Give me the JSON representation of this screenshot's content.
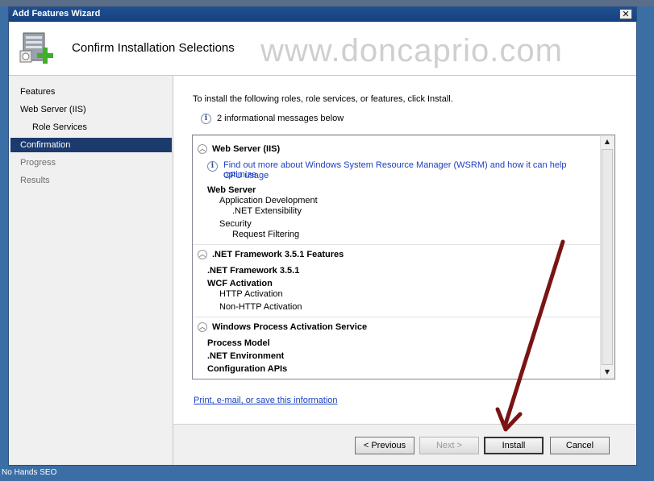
{
  "window": {
    "title": "Add Features Wizard"
  },
  "header": {
    "title": "Confirm Installation Selections",
    "watermark": "www.doncaprio.com"
  },
  "nav": {
    "items": [
      {
        "label": "Features"
      },
      {
        "label": "Web Server (IIS)"
      },
      {
        "label": "Role Services"
      },
      {
        "label": "Confirmation"
      },
      {
        "label": "Progress"
      },
      {
        "label": "Results"
      }
    ]
  },
  "content": {
    "intro": "To install the following roles, role services, or features, click Install.",
    "info_count_text": "2 informational messages below",
    "sections": [
      {
        "title": "Web Server (IIS)",
        "link": "Find out more about Windows System Resource Manager (WSRM) and how it can help optimize CPU usage",
        "link_line1": "Find out more about Windows System Resource Manager (WSRM) and how it can help optimize",
        "link_line2": "CPU usage",
        "items": [
          "Web Server",
          "Application Development",
          ".NET Extensibility",
          "Security",
          "Request Filtering"
        ]
      },
      {
        "title": ".NET Framework 3.5.1 Features",
        "items": [
          ".NET Framework 3.5.1",
          "WCF Activation",
          "HTTP Activation",
          "Non-HTTP Activation"
        ]
      },
      {
        "title": "Windows Process Activation Service",
        "items": [
          "Process Model",
          ".NET Environment",
          "Configuration APIs"
        ]
      }
    ],
    "print_link": "Print, e-mail, or save this information"
  },
  "buttons": {
    "previous": "< Previous",
    "next": "Next >",
    "install": "Install",
    "cancel": "Cancel"
  },
  "desktop": {
    "label": "No Hands SEO"
  },
  "colors": {
    "selection": "#1d3a6d",
    "title_bar": "#1f4f92",
    "annotation_arrow": "#7a1414",
    "link": "#1a3fc1"
  }
}
